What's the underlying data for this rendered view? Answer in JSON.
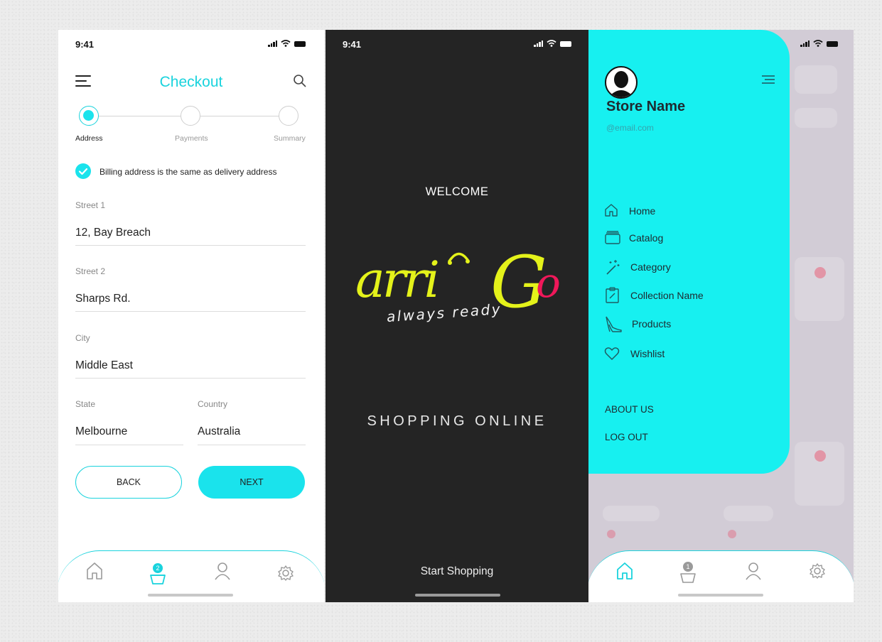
{
  "status_time": "9:41",
  "checkout": {
    "title": "Checkout",
    "steps": [
      "Address",
      "Payments",
      "Summary"
    ],
    "billing_same_label": "Billing address is the same as delivery address",
    "fields": {
      "street1": {
        "label": "Street 1",
        "value": "12, Bay Breach"
      },
      "street2": {
        "label": "Street 2",
        "value": "Sharps Rd."
      },
      "city": {
        "label": "City",
        "value": "Middle East"
      },
      "state": {
        "label": "State",
        "value": "Melbourne"
      },
      "country": {
        "label": "Country",
        "value": "Australia"
      }
    },
    "back_label": "BACK",
    "next_label": "NEXT",
    "cart_badge": "2"
  },
  "splash": {
    "welcome": "WELCOME",
    "logo_text": "arriGo",
    "logo_tagline": "always ready",
    "tagline": "SHOPPING ONLINE",
    "start_label": "Start Shopping"
  },
  "drawer": {
    "store_name": "Store Name",
    "email": "@email.com",
    "menu": [
      {
        "label": "Home",
        "icon": "home-icon"
      },
      {
        "label": "Catalog",
        "icon": "catalog-icon"
      },
      {
        "label": "Category",
        "icon": "magic-wand-icon"
      },
      {
        "label": "Collection Name",
        "icon": "clipboard-icon"
      },
      {
        "label": "Products",
        "icon": "high-heel-icon"
      },
      {
        "label": "Wishlist",
        "icon": "heart-icon"
      }
    ],
    "about_label": "ABOUT US",
    "logout_label": "LOG OUT",
    "cart_badge": "1"
  },
  "colors": {
    "accent": "#1ae3ec",
    "drawer_bg": "#17f0f0",
    "splash_bg": "#242424",
    "logo_yellow": "#e4f21a",
    "logo_pink": "#f0185a"
  }
}
